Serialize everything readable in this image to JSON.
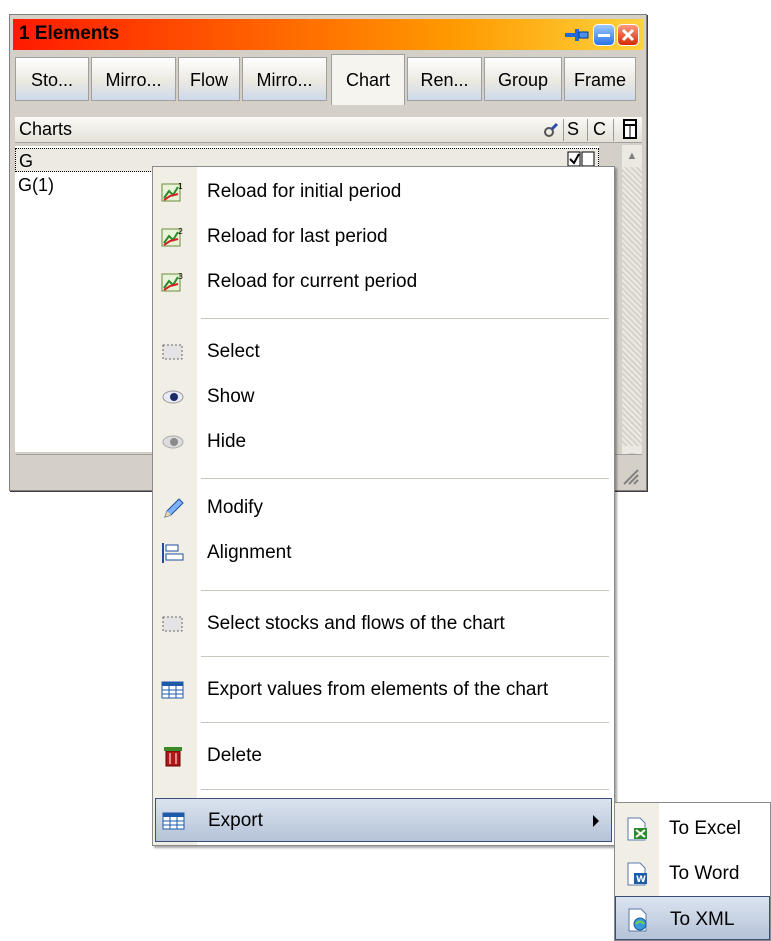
{
  "window": {
    "title": "1  Elements",
    "tabs": [
      "Sto...",
      "Mirro...",
      "Flow",
      "Mirro...",
      "Chart",
      "Ren...",
      "Group",
      "Frame"
    ],
    "active_tab": "Chart"
  },
  "list_header": {
    "name_col": "Charts",
    "s_col": "S",
    "c_col": "C"
  },
  "list_rows": [
    {
      "name": "G",
      "selected": true
    },
    {
      "name": "G(1)",
      "selected": false
    }
  ],
  "context_menu": {
    "items": [
      {
        "label": "Reload for initial period",
        "icon": "chart-reload-1-icon"
      },
      {
        "label": "Reload for last period",
        "icon": "chart-reload-2-icon"
      },
      {
        "label": "Reload for current period",
        "icon": "chart-reload-3-icon"
      },
      {
        "label": "Select",
        "icon": "select-icon"
      },
      {
        "label": "Show",
        "icon": "eye-icon"
      },
      {
        "label": "Hide",
        "icon": "eye-gray-icon"
      },
      {
        "label": "Modify",
        "icon": "pencil-icon"
      },
      {
        "label": "Alignment",
        "icon": "alignment-icon"
      },
      {
        "label": "Select stocks and flows of the chart",
        "icon": "select-icon"
      },
      {
        "label": "Export values from elements of the chart",
        "icon": "table-icon"
      },
      {
        "label": "Delete",
        "icon": "trash-icon"
      },
      {
        "label": "Export",
        "icon": "table-icon"
      }
    ]
  },
  "export_submenu": {
    "items": [
      {
        "label": "To Excel",
        "icon": "excel-icon"
      },
      {
        "label": "To Word",
        "icon": "word-icon"
      },
      {
        "label": "To XML",
        "icon": "xml-icon"
      }
    ]
  },
  "colors": {
    "title_start": "#ff1a00",
    "title_end": "#ffd23c",
    "highlight": "#b5c3d8",
    "highlight_border": "#3c4f78"
  }
}
